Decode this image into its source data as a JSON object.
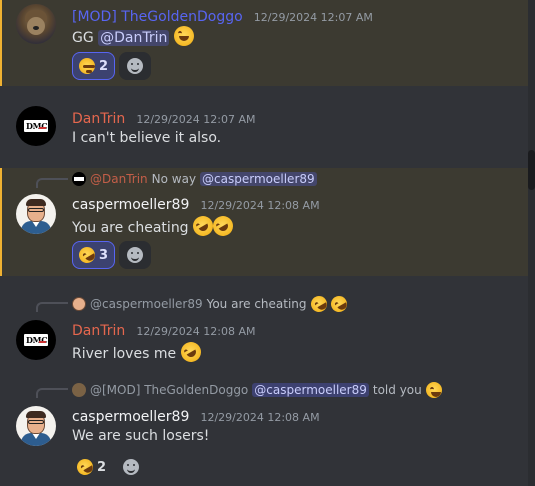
{
  "messages": [
    {
      "username": "[MOD] TheGoldenDoggo",
      "timestamp": "12/29/2024 12:07 AM",
      "text_prefix": "GG",
      "mention": "@DanTrin",
      "emoji": "joy-emoji",
      "reactions": [
        {
          "emoji": "dizzy-face-emoji",
          "count": "2",
          "active": true
        }
      ]
    },
    {
      "username": "DanTrin",
      "timestamp": "12/29/2024 12:07 AM",
      "text": "I can't believe it also."
    },
    {
      "reply": {
        "user": "@DanTrin",
        "text": "No way",
        "mention": "@caspermoeller89"
      },
      "username": "caspermoeller89",
      "timestamp": "12/29/2024 12:08 AM",
      "text": "You are cheating",
      "reactions": [
        {
          "emoji": "rofl-emoji",
          "count": "3",
          "active": true
        }
      ]
    },
    {
      "reply": {
        "user": "@caspermoeller89",
        "text": "You are cheating"
      },
      "username": "DanTrin",
      "timestamp": "12/29/2024 12:08 AM",
      "text": "River loves me"
    },
    {
      "reply": {
        "user": "@[MOD] TheGoldenDoggo",
        "mention": "@caspermoeller89",
        "text": "told you"
      },
      "username": "caspermoeller89",
      "timestamp": "12/29/2024 12:08 AM",
      "text": "We are such losers!",
      "reactions": [
        {
          "emoji": "rofl-emoji",
          "count": "2",
          "active": false
        }
      ]
    }
  ],
  "colors": {
    "background": "#313338",
    "highlight": "#3c3a31",
    "highlight_bar": "#f0b232",
    "mod_username": "#5865f2",
    "dan_username": "#e5674e",
    "mention_bg": "#3c4270"
  }
}
